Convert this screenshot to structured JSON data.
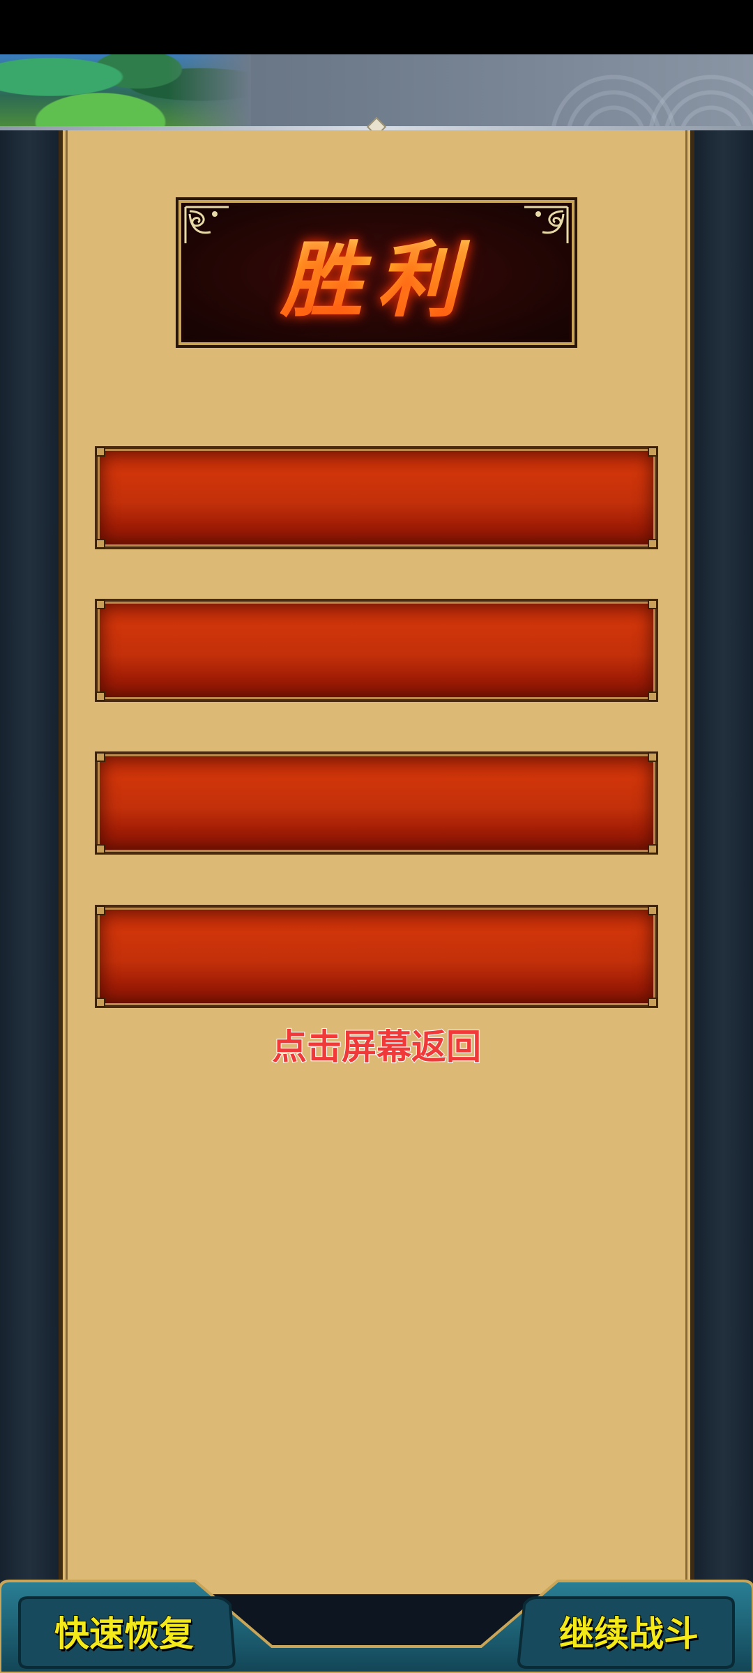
{
  "result": {
    "title": "胜利"
  },
  "rewards": {
    "slots": [
      {
        "label": ""
      },
      {
        "label": ""
      },
      {
        "label": ""
      },
      {
        "label": ""
      }
    ]
  },
  "prompt": {
    "tap_to_return": "点击屏幕返回"
  },
  "footer": {
    "quick_recover_label": "快速恢复",
    "continue_battle_label": "继续战斗"
  },
  "colors": {
    "paper": "#ddb976",
    "plaque_bg": "#1e0504",
    "reward_bar": "#c3300a",
    "button_text": "#f4ea1a",
    "prompt_text": "#f03a3a",
    "frame_teal": "#1d5d72"
  }
}
